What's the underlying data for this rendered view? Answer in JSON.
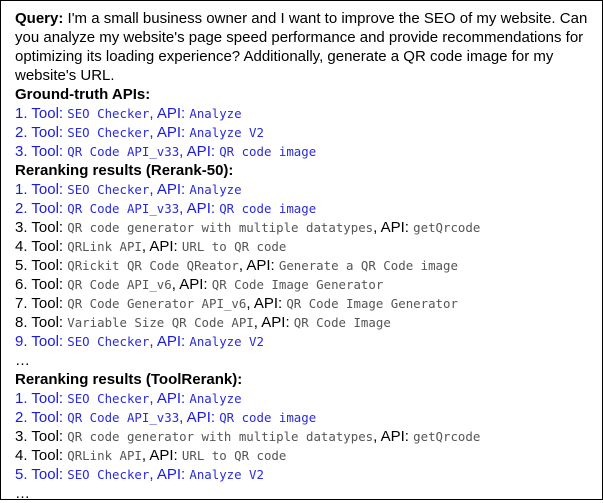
{
  "query": {
    "label": "Query:",
    "text": " I'm a small business owner and I want to improve the SEO of my website. Can you analyze my website's page speed performance and provide recommendations for optimizing its loading experience? Additionally, generate a QR code image for my website's URL."
  },
  "ground_truth": {
    "heading": "Ground-truth APIs:",
    "items": [
      {
        "num": "1.",
        "tool": "SEO Checker",
        "api": "Analyze"
      },
      {
        "num": "2.",
        "tool": "SEO Checker",
        "api": "Analyze V2"
      },
      {
        "num": "3.",
        "tool": "QR Code API_v33",
        "api": "QR code image"
      }
    ]
  },
  "rerank50": {
    "heading": "Reranking results (Rerank-50):",
    "items": [
      {
        "num": "1.",
        "tool": "SEO Checker",
        "api": "Analyze",
        "correct": true
      },
      {
        "num": "2.",
        "tool": "QR Code API_v33",
        "api": "QR code image",
        "correct": true
      },
      {
        "num": "3.",
        "tool": "QR code generator with multiple datatypes",
        "api": "getQrcode",
        "correct": false
      },
      {
        "num": "4.",
        "tool": "QRLink API",
        "api": "URL to QR code",
        "correct": false
      },
      {
        "num": "5.",
        "tool": "QRickit QR Code QReator",
        "api": "Generate a QR Code image",
        "correct": false
      },
      {
        "num": "6.",
        "tool": "QR Code API_v6",
        "api": "QR Code Image Generator",
        "correct": false
      },
      {
        "num": "7.",
        "tool": "QR Code Generator API_v6",
        "api": "QR Code Image Generator",
        "correct": false
      },
      {
        "num": "8.",
        "tool": "Variable Size QR Code API",
        "api": "QR Code Image",
        "correct": false
      },
      {
        "num": "9.",
        "tool": "SEO Checker",
        "api": "Analyze V2",
        "correct": true
      }
    ],
    "ellipsis": "…"
  },
  "toolrerank": {
    "heading": "Reranking results (ToolRerank):",
    "items": [
      {
        "num": "1.",
        "tool": "SEO Checker",
        "api": "Analyze",
        "correct": true
      },
      {
        "num": "2.",
        "tool": "QR Code API_v33",
        "api": "QR code image",
        "correct": true
      },
      {
        "num": "3.",
        "tool": "QR code generator with multiple datatypes",
        "api": "getQrcode",
        "correct": false
      },
      {
        "num": "4.",
        "tool": "QRLink API",
        "api": "URL to QR code",
        "correct": false
      },
      {
        "num": "5.",
        "tool": "SEO Checker",
        "api": "Analyze V2",
        "correct": true
      }
    ],
    "ellipsis": "…"
  },
  "labels": {
    "tool": "Tool: ",
    "api": "API: "
  },
  "colors": {
    "correct_label": "#1a1ae0",
    "correct_value": "#2b2bd9",
    "incorrect_value": "#555555",
    "text": "#000000"
  }
}
